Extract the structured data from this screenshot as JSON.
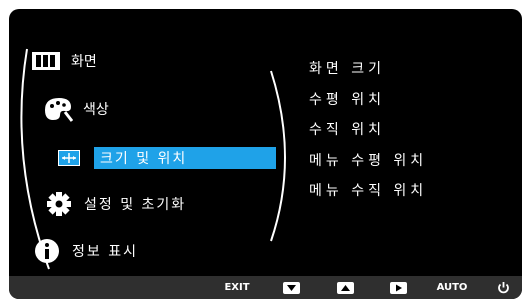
{
  "menu": {
    "items": [
      {
        "label": "화면",
        "icon": "picture-icon"
      },
      {
        "label": "색상",
        "icon": "palette-icon"
      },
      {
        "label": "크기 및 위치",
        "icon": "size-position-icon",
        "selected": true
      },
      {
        "label": "설정 및 초기화",
        "icon": "gear-icon"
      },
      {
        "label": "정보 표시",
        "icon": "info-icon"
      }
    ]
  },
  "submenu": {
    "items": [
      "화면 크기",
      "수평 위치",
      "수직 위치",
      "메뉴 수평 위치",
      "메뉴 수직 위치"
    ]
  },
  "bottom_bar": {
    "exit_label": "EXIT",
    "auto_label": "AUTO",
    "buttons": [
      "down-arrow-button",
      "up-arrow-button",
      "enter-button",
      "power-button"
    ]
  },
  "colors": {
    "background": "#000000",
    "highlight": "#1fa2e8",
    "bottom_bar": "#2f2f2f"
  }
}
